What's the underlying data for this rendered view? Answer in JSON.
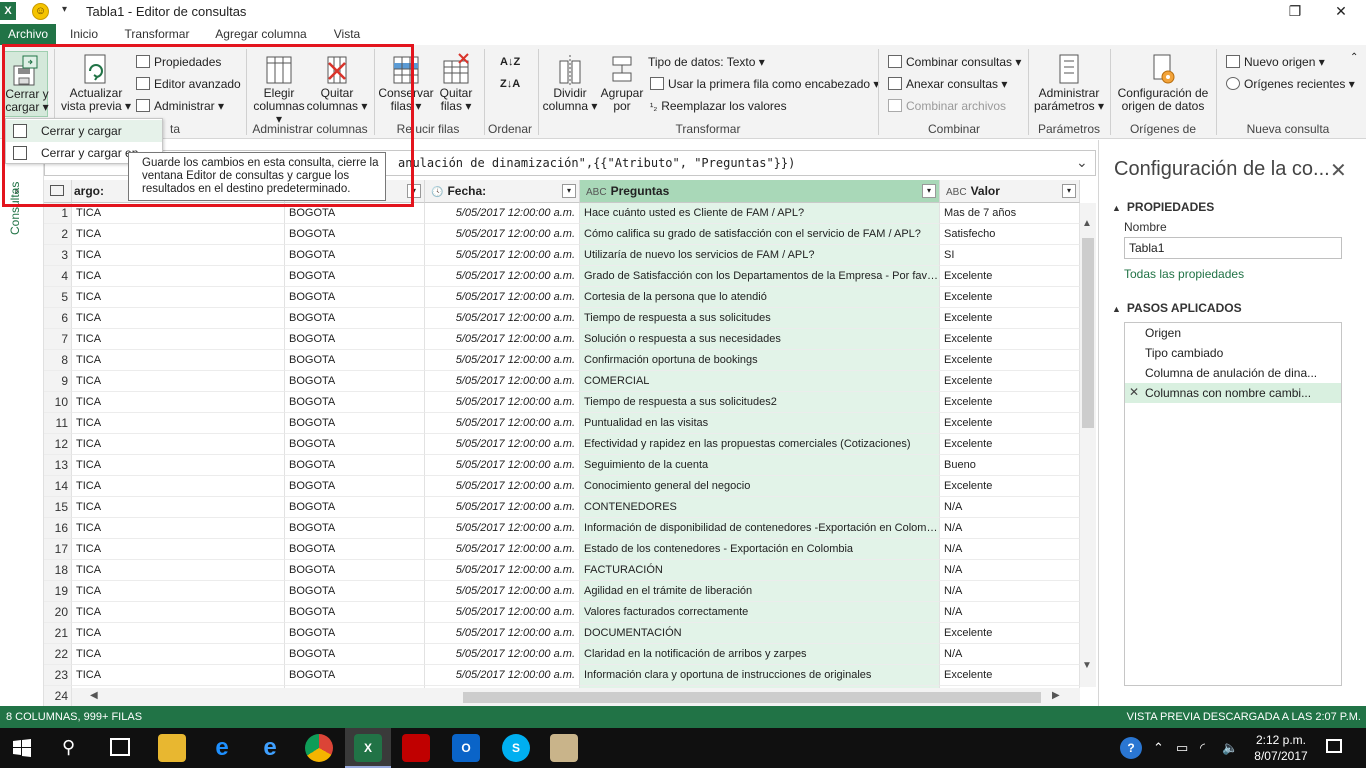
{
  "window": {
    "title": "Tabla1 - Editor de consultas",
    "restore_glyph": "❐",
    "close_glyph": "✕",
    "qat_glyph": "▾"
  },
  "tabs": [
    "Archivo",
    "Inicio",
    "Transformar",
    "Agregar columna",
    "Vista"
  ],
  "ribbon": {
    "cerrar_cargar": "Cerrar y cargar ▾",
    "actualizar": "Actualizar vista previa ▾",
    "propiedades": "Propiedades",
    "editor_avanzado": "Editor avanzado",
    "administrar": "Administrar ▾",
    "elegir_columnas": "Elegir columnas ▾",
    "quitar_columnas": "Quitar columnas ▾",
    "conservar_filas": "Conservar filas ▾",
    "quitar_filas": "Quitar filas ▾",
    "dividir_columna": "Dividir columna ▾",
    "agrupar_por": "Agrupar por",
    "tipo_datos": "Tipo de datos: Texto ▾",
    "primera_fila": "Usar la primera fila como encabezado ▾",
    "reemplazar": "Reemplazar los valores",
    "combinar_consultas": "Combinar consultas ▾",
    "anexar_consultas": "Anexar consultas ▾",
    "combinar_archivos": "Combinar archivos",
    "admin_parametros": "Administrar parámetros ▾",
    "config_origen": "Configuración de origen de datos",
    "nuevo_origen": "Nuevo origen ▾",
    "origenes_recientes": "Orígenes recientes ▾",
    "groups": {
      "consulta_partial": "ta",
      "administrar_columnas": "Administrar columnas",
      "reducir_filas": "Re  ucir filas",
      "ordenar": "Ordenar",
      "transformar": "Transformar",
      "combinar": "Combinar",
      "parametros": "Parámetros",
      "origenes": "Orígenes de datos",
      "nueva_consulta": "Nueva consulta"
    }
  },
  "dropdown": {
    "item1": "Cerrar y cargar",
    "item2": "Cerrar y cargar en..."
  },
  "tooltip": "Guarde los cambios en esta consulta, cierre la ventana Editor de consultas y cargue los resultados en el destino predeterminado.",
  "side": {
    "label": "Consultas",
    "chevron": "›"
  },
  "formula": {
    "text": "anulación de dinamización\",{{\"Atributo\", \"Preguntas\"}})",
    "chevron": "⌄"
  },
  "table": {
    "headers": {
      "cargo": "argo:",
      "fecha": "Fecha:",
      "preguntas": "Preguntas",
      "valor": "Valor"
    },
    "rows": [
      {
        "n": "1",
        "cargo": "TICA",
        "ciudad": "BOGOTA",
        "fecha": "5/05/2017 12:00:00 a.m.",
        "pregunta": "Hace cuánto usted es Cliente de FAM / APL?",
        "valor": "Mas de 7 años"
      },
      {
        "n": "2",
        "cargo": "TICA",
        "ciudad": "BOGOTA",
        "fecha": "5/05/2017 12:00:00 a.m.",
        "pregunta": "Cómo califica su grado de satisfacción con el servicio de FAM / APL?",
        "valor": "Satisfecho"
      },
      {
        "n": "3",
        "cargo": "TICA",
        "ciudad": "BOGOTA",
        "fecha": "5/05/2017 12:00:00 a.m.",
        "pregunta": "Utilizaría de nuevo los servicios de FAM / APL?",
        "valor": "SI"
      },
      {
        "n": "4",
        "cargo": "TICA",
        "ciudad": "BOGOTA",
        "fecha": "5/05/2017 12:00:00 a.m.",
        "pregunta": "Grado de Satisfacción con los Departamentos de la Empresa - Por favor califique",
        "valor": "Excelente"
      },
      {
        "n": "5",
        "cargo": "TICA",
        "ciudad": "BOGOTA",
        "fecha": "5/05/2017 12:00:00 a.m.",
        "pregunta": "Cortesia de la persona que lo atendió",
        "valor": "Excelente"
      },
      {
        "n": "6",
        "cargo": "TICA",
        "ciudad": "BOGOTA",
        "fecha": "5/05/2017 12:00:00 a.m.",
        "pregunta": "Tiempo de respuesta a sus solicitudes",
        "valor": "Excelente"
      },
      {
        "n": "7",
        "cargo": "TICA",
        "ciudad": "BOGOTA",
        "fecha": "5/05/2017 12:00:00 a.m.",
        "pregunta": "Solución o respuesta a sus necesidades",
        "valor": "Excelente"
      },
      {
        "n": "8",
        "cargo": "TICA",
        "ciudad": "BOGOTA",
        "fecha": "5/05/2017 12:00:00 a.m.",
        "pregunta": "Confirmación oportuna de bookings",
        "valor": "Excelente"
      },
      {
        "n": "9",
        "cargo": "TICA",
        "ciudad": "BOGOTA",
        "fecha": "5/05/2017 12:00:00 a.m.",
        "pregunta": "COMERCIAL",
        "valor": "Excelente"
      },
      {
        "n": "10",
        "cargo": "TICA",
        "ciudad": "BOGOTA",
        "fecha": "5/05/2017 12:00:00 a.m.",
        "pregunta": "Tiempo de respuesta a sus solicitudes2",
        "valor": "Excelente"
      },
      {
        "n": "11",
        "cargo": "TICA",
        "ciudad": "BOGOTA",
        "fecha": "5/05/2017 12:00:00 a.m.",
        "pregunta": "Puntualidad en las visitas",
        "valor": "Excelente"
      },
      {
        "n": "12",
        "cargo": "TICA",
        "ciudad": "BOGOTA",
        "fecha": "5/05/2017 12:00:00 a.m.",
        "pregunta": "Efectividad y rapidez en las propuestas comerciales (Cotizaciones)",
        "valor": "Excelente"
      },
      {
        "n": "13",
        "cargo": "TICA",
        "ciudad": "BOGOTA",
        "fecha": "5/05/2017 12:00:00 a.m.",
        "pregunta": "Seguimiento de la cuenta",
        "valor": "Bueno"
      },
      {
        "n": "14",
        "cargo": "TICA",
        "ciudad": "BOGOTA",
        "fecha": "5/05/2017 12:00:00 a.m.",
        "pregunta": "Conocimiento general del negocio",
        "valor": "Excelente"
      },
      {
        "n": "15",
        "cargo": "TICA",
        "ciudad": "BOGOTA",
        "fecha": "5/05/2017 12:00:00 a.m.",
        "pregunta": "CONTENEDORES",
        "valor": "N/A"
      },
      {
        "n": "16",
        "cargo": "TICA",
        "ciudad": "BOGOTA",
        "fecha": "5/05/2017 12:00:00 a.m.",
        "pregunta": "Información de disponibilidad de contenedores -Exportación en Colombia",
        "valor": "N/A"
      },
      {
        "n": "17",
        "cargo": "TICA",
        "ciudad": "BOGOTA",
        "fecha": "5/05/2017 12:00:00 a.m.",
        "pregunta": "Estado de los contenedores - Exportación en Colombia",
        "valor": "N/A"
      },
      {
        "n": "18",
        "cargo": "TICA",
        "ciudad": "BOGOTA",
        "fecha": "5/05/2017 12:00:00 a.m.",
        "pregunta": "FACTURACIÓN",
        "valor": "N/A"
      },
      {
        "n": "19",
        "cargo": "TICA",
        "ciudad": "BOGOTA",
        "fecha": "5/05/2017 12:00:00 a.m.",
        "pregunta": "Agilidad en el trámite de liberación",
        "valor": "N/A"
      },
      {
        "n": "20",
        "cargo": "TICA",
        "ciudad": "BOGOTA",
        "fecha": "5/05/2017 12:00:00 a.m.",
        "pregunta": "Valores facturados correctamente",
        "valor": "N/A"
      },
      {
        "n": "21",
        "cargo": "TICA",
        "ciudad": "BOGOTA",
        "fecha": "5/05/2017 12:00:00 a.m.",
        "pregunta": "DOCUMENTACIÓN",
        "valor": "Excelente"
      },
      {
        "n": "22",
        "cargo": "TICA",
        "ciudad": "BOGOTA",
        "fecha": "5/05/2017 12:00:00 a.m.",
        "pregunta": "Claridad en la notificación de arribos y zarpes",
        "valor": "N/A"
      },
      {
        "n": "23",
        "cargo": "TICA",
        "ciudad": "BOGOTA",
        "fecha": "5/05/2017 12:00:00 a.m.",
        "pregunta": "Información clara y oportuna de instrucciones de originales",
        "valor": "Excelente"
      },
      {
        "n": "24",
        "cargo": "",
        "ciudad": "",
        "fecha": "",
        "pregunta": "",
        "valor": ""
      }
    ]
  },
  "pane": {
    "title": "Configuración de la co...",
    "close": "✕",
    "propiedades": "PROPIEDADES",
    "nombre_label": "Nombre",
    "nombre_value": "Tabla1",
    "todas": "Todas las propiedades",
    "pasos_title": "PASOS APLICADOS",
    "steps": [
      "Origen",
      "Tipo cambiado",
      "Columna de anulación de dina...",
      "Columnas con nombre cambi..."
    ],
    "step_delete": "✕"
  },
  "status": {
    "left": "8 COLUMNAS, 999+ FILAS",
    "right": "VISTA PREVIA DESCARGADA A LAS 2:07 P.M."
  },
  "taskbar": {
    "time": "2:12 p.m.",
    "date": "8/07/2017"
  },
  "colors": {
    "accent": "#217346",
    "highlight": "#e3141d",
    "selected_col": "#e2f3e8"
  }
}
